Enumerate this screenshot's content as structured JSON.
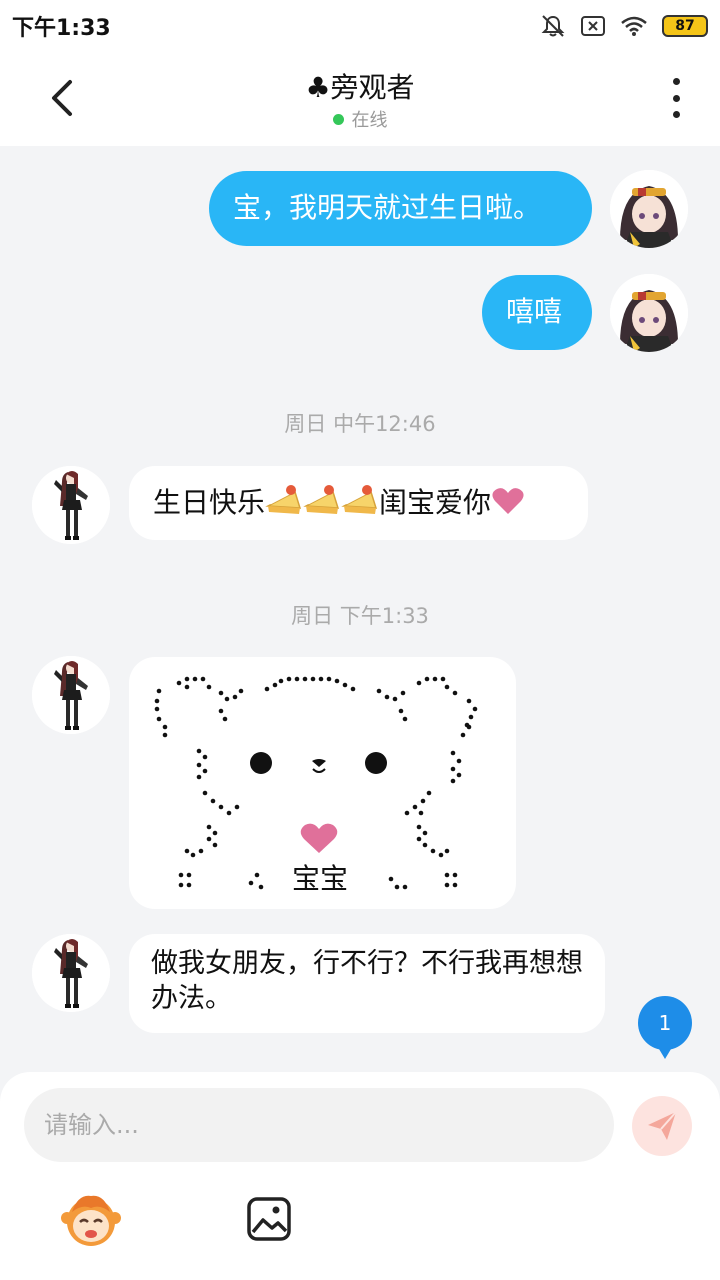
{
  "status_bar": {
    "time": "下午1:33",
    "battery": "87",
    "icons": [
      "mute-icon",
      "sim-icon",
      "wifi-icon",
      "battery-icon"
    ]
  },
  "header": {
    "title": "♣旁观者",
    "status": "在线"
  },
  "messages": [
    {
      "side": "out",
      "text": "宝，我明天就过生日啦。"
    },
    {
      "side": "out",
      "text": "嘻嘻"
    },
    {
      "side": "timestamp",
      "text": "周日 中午12:46"
    },
    {
      "side": "in",
      "text_before": "生日快乐",
      "emoji": [
        "cake-emoji",
        "cake-emoji",
        "cake-emoji"
      ],
      "text_after": "闺宝爱你",
      "trailing_emoji": "heart-emoji"
    },
    {
      "side": "timestamp",
      "text": "周日 下午1:33"
    },
    {
      "side": "in",
      "kind": "braille-bear-art",
      "caption": "宝宝"
    },
    {
      "side": "in",
      "text": "做我女朋友，行不行？不行我再想想办法。"
    }
  ],
  "unread_count": "1",
  "composer": {
    "placeholder": "请输入..."
  },
  "colors": {
    "outgoing_bubble": "#29b6f6",
    "unread_badge": "#1e8de8",
    "send_button": "#fde3df",
    "online": "#34c759"
  }
}
